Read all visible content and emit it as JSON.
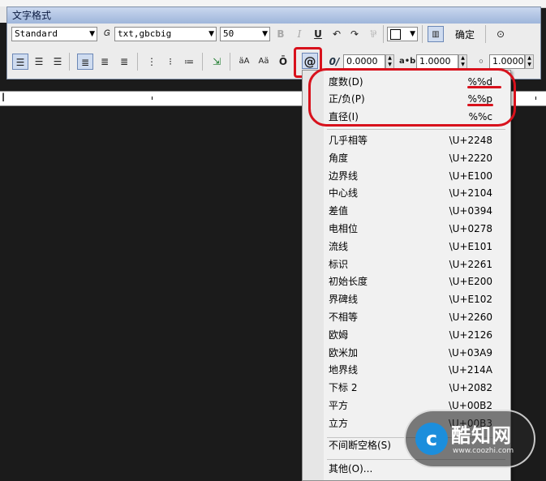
{
  "toolbar": {
    "title": "文字格式",
    "style_value": "Standard",
    "font_value": "txt,gbcbig",
    "height_value": "50",
    "bold_label": "B",
    "italic_label": "I",
    "underline_label": "U",
    "ok_label": "确定",
    "oblique_value": "0.0000",
    "tracking_value": "1.0000",
    "width_factor_value": "1.0000",
    "symbol_label": "@"
  },
  "menu": {
    "top_items": [
      {
        "label": "度数(D)",
        "code": "%%d"
      },
      {
        "label": "正/负(P)",
        "code": "%%p"
      },
      {
        "label": "直径(I)",
        "code": "%%c"
      }
    ],
    "symbols": [
      {
        "label": "几乎相等",
        "code": "\\U+2248"
      },
      {
        "label": "角度",
        "code": "\\U+2220"
      },
      {
        "label": "边界线",
        "code": "\\U+E100"
      },
      {
        "label": "中心线",
        "code": "\\U+2104"
      },
      {
        "label": "差值",
        "code": "\\U+0394"
      },
      {
        "label": "电相位",
        "code": "\\U+0278"
      },
      {
        "label": "流线",
        "code": "\\U+E101"
      },
      {
        "label": "标识",
        "code": "\\U+2261"
      },
      {
        "label": "初始长度",
        "code": "\\U+E200"
      },
      {
        "label": "界碑线",
        "code": "\\U+E102"
      },
      {
        "label": "不相等",
        "code": "\\U+2260"
      },
      {
        "label": "欧姆",
        "code": "\\U+2126"
      },
      {
        "label": "欧米加",
        "code": "\\U+03A9"
      },
      {
        "label": "地界线",
        "code": "\\U+214A"
      },
      {
        "label": "下标 2",
        "code": "\\U+2082"
      },
      {
        "label": "平方",
        "code": "\\U+00B2"
      },
      {
        "label": "立方",
        "code": "\\U+00B3"
      }
    ],
    "nbsp_label": "不间断空格(S)",
    "other_label": "其他(O)..."
  },
  "watermark": {
    "name": "酷知网",
    "url": "www.coozhi.com",
    "logo_glyph": "c"
  },
  "colors": {
    "annotation_red": "#d8111c",
    "title_bar": "#9fb6db",
    "editor_bg": "#1b1b1b"
  }
}
